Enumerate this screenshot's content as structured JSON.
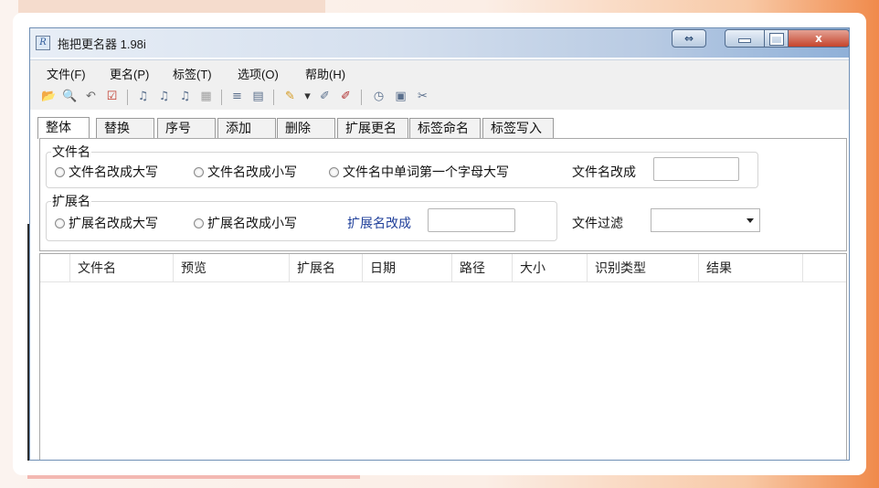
{
  "window": {
    "title": "拖把更名器 1.98i",
    "icon": "document-app-icon"
  },
  "titlebar_buttons": {
    "resize": "⇔",
    "close": "x"
  },
  "menu": [
    {
      "label": "文件(F)"
    },
    {
      "label": "更名(P)"
    },
    {
      "label": "标签(T)"
    },
    {
      "label": "选项(O)"
    },
    {
      "label": "帮助(H)"
    }
  ],
  "toolbar": [
    {
      "icon": "open-folder-icon",
      "glyph": "📂"
    },
    {
      "icon": "search-icon",
      "glyph": "🔍"
    },
    {
      "icon": "undo-icon",
      "glyph": "↶"
    },
    {
      "icon": "checkbox-icon",
      "glyph": "☑"
    },
    {
      "icon": "music-note-icon-1",
      "glyph": "♫"
    },
    {
      "icon": "music-note-icon-2",
      "glyph": "♫"
    },
    {
      "icon": "music-note-icon-3",
      "glyph": "♫"
    },
    {
      "icon": "disabled-icon",
      "glyph": "▦"
    },
    {
      "icon": "list-icon",
      "glyph": "≡"
    },
    {
      "icon": "document-icon",
      "glyph": "▤"
    },
    {
      "icon": "pen-icon",
      "glyph": "✎"
    },
    {
      "icon": "dropdown-arrow-icon",
      "glyph": "▾"
    },
    {
      "icon": "tag-icon",
      "glyph": "✐"
    },
    {
      "icon": "tag-delete-icon",
      "glyph": "✐"
    },
    {
      "icon": "clock-icon",
      "glyph": "◷"
    },
    {
      "icon": "media-icon",
      "glyph": "▣"
    },
    {
      "icon": "tools-icon",
      "glyph": "✂"
    }
  ],
  "tabs": [
    {
      "label": "整体",
      "active": true
    },
    {
      "label": "替换"
    },
    {
      "label": "序号"
    },
    {
      "label": "添加"
    },
    {
      "label": "删除"
    },
    {
      "label": "扩展更名"
    },
    {
      "label": "标签命名"
    },
    {
      "label": "标签写入"
    }
  ],
  "filename_group": {
    "label": "文件名",
    "options": [
      "文件名改成大写",
      "文件名改成小写",
      "文件名中单词第一个字母大写"
    ],
    "rename_label": "文件名改成",
    "rename_value": ""
  },
  "extension_group": {
    "label": "扩展名",
    "options": [
      "扩展名改成大写",
      "扩展名改成小写"
    ],
    "rename_label": "扩展名改成",
    "rename_value": "",
    "filter_label": "文件过滤",
    "filter_value": ""
  },
  "columns": [
    "文件名",
    "预览",
    "扩展名",
    "日期",
    "路径",
    "大小",
    "识别类型",
    "结果"
  ],
  "colors": {
    "accent": "#f08a4b",
    "title_gradient_end": "#8fb0d8",
    "close_button": "#c5442c",
    "blue_label": "#1f3f9a"
  }
}
